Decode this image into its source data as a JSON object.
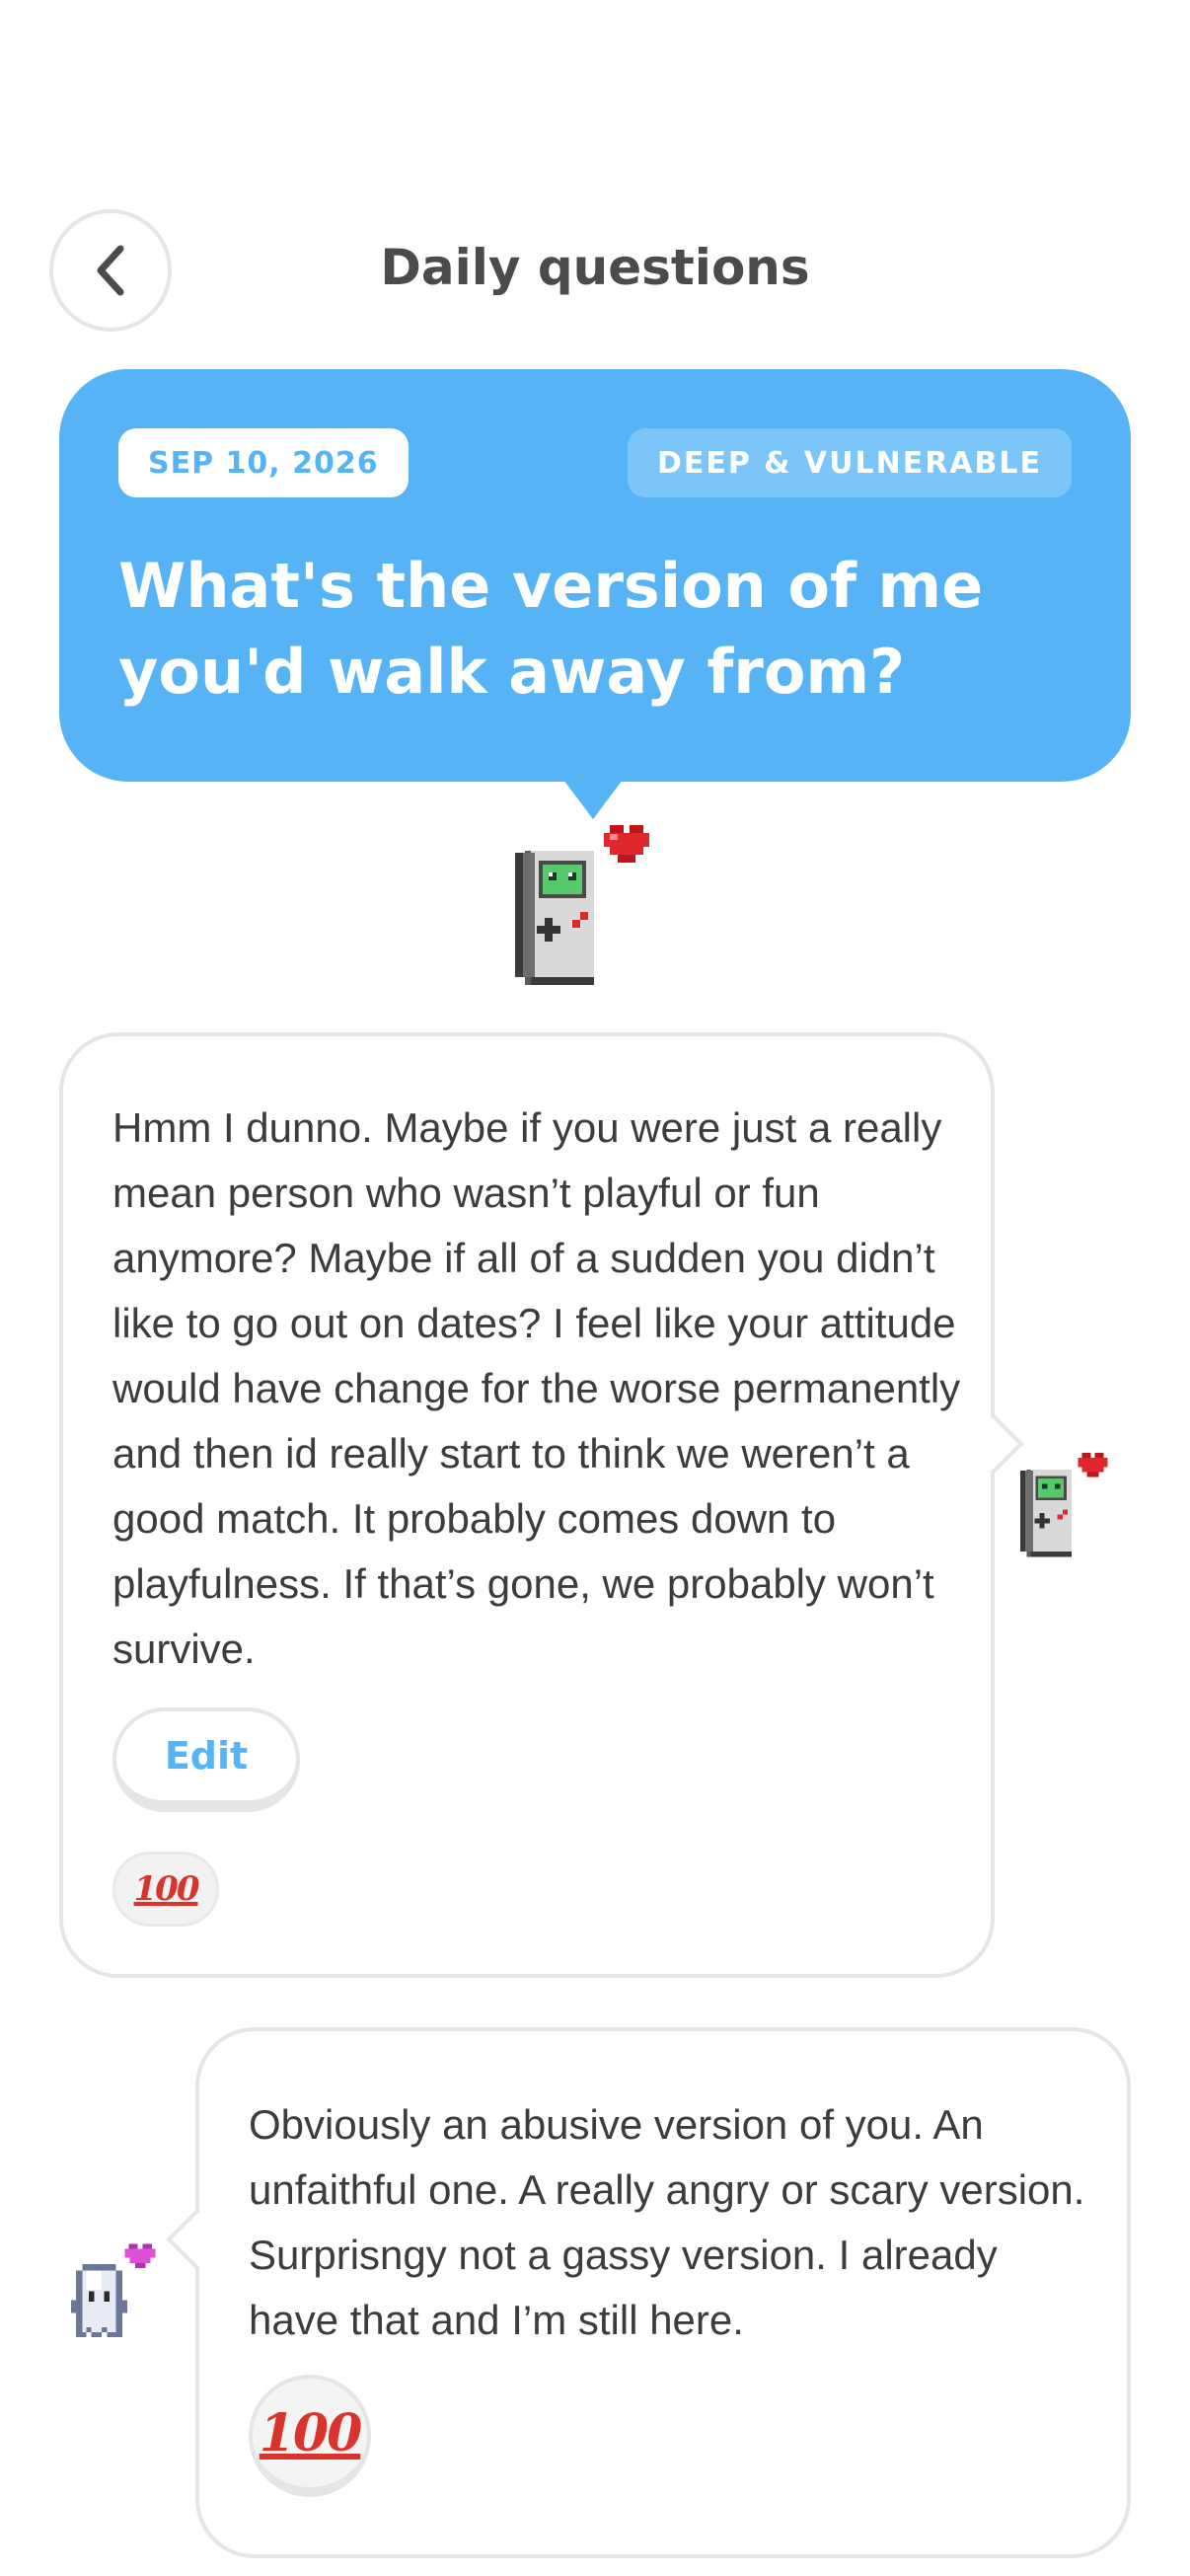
{
  "header": {
    "title": "Daily questions",
    "back_icon": "chevron-left-icon"
  },
  "question": {
    "date": "SEP 10, 2026",
    "category": "DEEP & VULNERABLE",
    "text": "What's the version of me you'd walk away from?",
    "color": "#56b3f5",
    "asker_avatar": "gameboy-heart-icon"
  },
  "answers": [
    {
      "avatar": "gameboy-heart-icon",
      "text": "Hmm I dunno. Maybe if you were just a really mean person who wasn’t playful or fun anymore? Maybe if all of a sudden you didn’t like to go out on dates? I feel like your attitude would have change for the worse permanently and then id really start to think we weren’t a good match. It probably comes down to playfulness. If that’s gone, we probably won’t survive.",
      "edit_label": "Edit",
      "reaction": "💯"
    },
    {
      "avatar": "ghost-heart-icon",
      "text": "Obviously an abusive version of you. An unfaithful one. A really angry or scary version. Surprisngy not a gassy version. I already have that and I’m still here.",
      "reaction": "💯"
    }
  ]
}
